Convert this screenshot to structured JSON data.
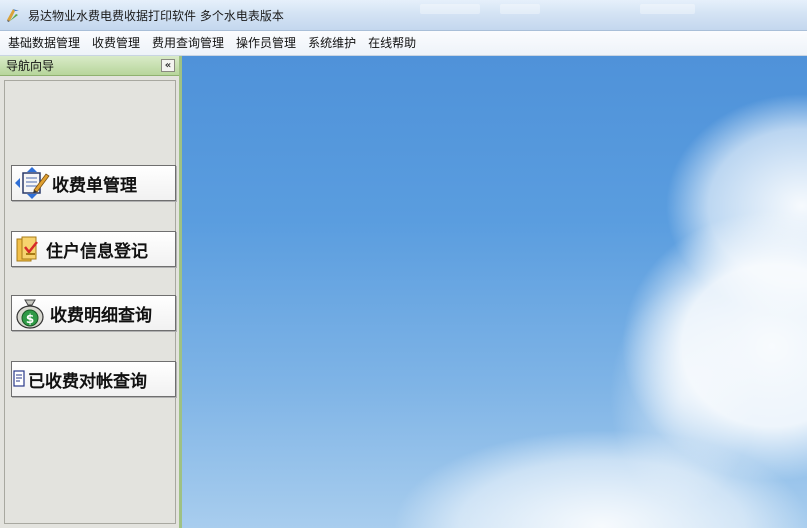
{
  "window": {
    "title": "易达物业水费电费收据打印软件 多个水电表版本",
    "icon": "app-logo-icon"
  },
  "menu": {
    "items": [
      {
        "label": "基础数据管理"
      },
      {
        "label": "收费管理"
      },
      {
        "label": "费用查询管理"
      },
      {
        "label": "操作员管理"
      },
      {
        "label": "系统维护"
      },
      {
        "label": "在线帮助"
      }
    ]
  },
  "nav": {
    "title": "导航向导",
    "collapse_label": "«",
    "buttons": [
      {
        "label": "收费单管理",
        "icon": "notebook-pencil-icon"
      },
      {
        "label": "住户信息登记",
        "icon": "folder-check-icon"
      },
      {
        "label": "收费明细查询",
        "icon": "money-bag-icon"
      },
      {
        "label": "已收费对帐查询",
        "icon": "document-icon"
      }
    ]
  },
  "colors": {
    "nav_border": "#9fc183",
    "nav_header": "#b7d59b",
    "sky": "#5a9ddf"
  }
}
